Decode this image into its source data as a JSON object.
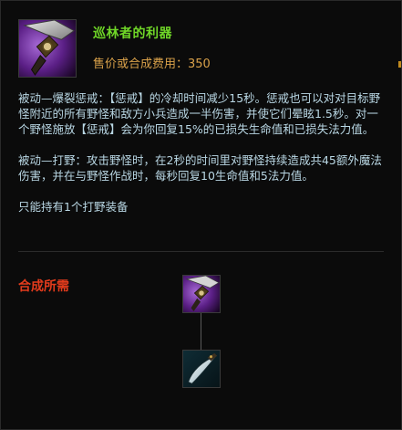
{
  "item": {
    "name": "巡林者的利器",
    "price_text": "售价或合成费用：350",
    "icon": "hunters-machete-purple-icon"
  },
  "description": {
    "passive1": "被动—爆裂惩戒：【惩戒】的冷却时间减少15秒。惩戒也可以对对目标野怪附近的所有野怪和敌方小兵造成一半伤害，并使它们晕眩1.5秒。对一个野怪施放【惩戒】会为你回复15%的已损失生命值和已损失法力值。",
    "passive2": "被动—打野：攻击野怪时，在2秒的时间里对野怪持续造成共45额外魔法伤害，并在与野怪作战时，每秒回复10生命值和5法力值。",
    "limit": "只能持有1个打野装备"
  },
  "recipe": {
    "title": "合成所需",
    "root_icon": "rangers-blade-icon",
    "component_icon": "hunters-machete-icon"
  },
  "colors": {
    "name": "#6fd627",
    "price": "#d9a14a",
    "desc": "#b9d7e4",
    "recipe_title": "#e33b1c",
    "background": "#0b0b0b"
  }
}
